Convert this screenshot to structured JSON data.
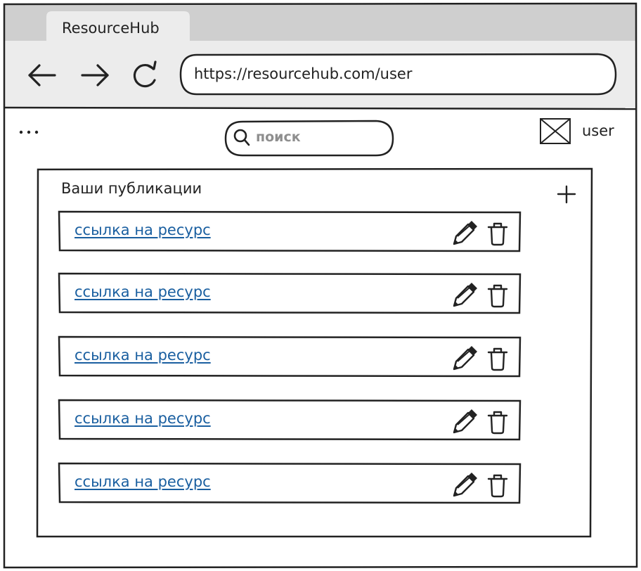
{
  "browser": {
    "tab_title": "ResourceHub",
    "url": "https://resourcehub.com/user",
    "nav_icons": [
      "back-arrow-icon",
      "forward-arrow-icon",
      "reload-icon"
    ]
  },
  "header": {
    "menu_icon": "more-dots-icon",
    "search_placeholder": "поиск",
    "user_label": "user",
    "avatar_icon": "image-placeholder-icon"
  },
  "publications": {
    "title": "Ваши публикации",
    "add_icon": "plus-icon",
    "items": [
      {
        "label": "ссылка на ресурс",
        "edit_icon": "pencil-icon",
        "delete_icon": "trash-icon"
      },
      {
        "label": "ссылка на ресурс",
        "edit_icon": "pencil-icon",
        "delete_icon": "trash-icon"
      },
      {
        "label": "ссылка на ресурс",
        "edit_icon": "pencil-icon",
        "delete_icon": "trash-icon"
      },
      {
        "label": "ссылка на ресурс",
        "edit_icon": "pencil-icon",
        "delete_icon": "trash-icon"
      },
      {
        "label": "ссылка на ресурс",
        "edit_icon": "pencil-icon",
        "delete_icon": "trash-icon"
      }
    ]
  }
}
